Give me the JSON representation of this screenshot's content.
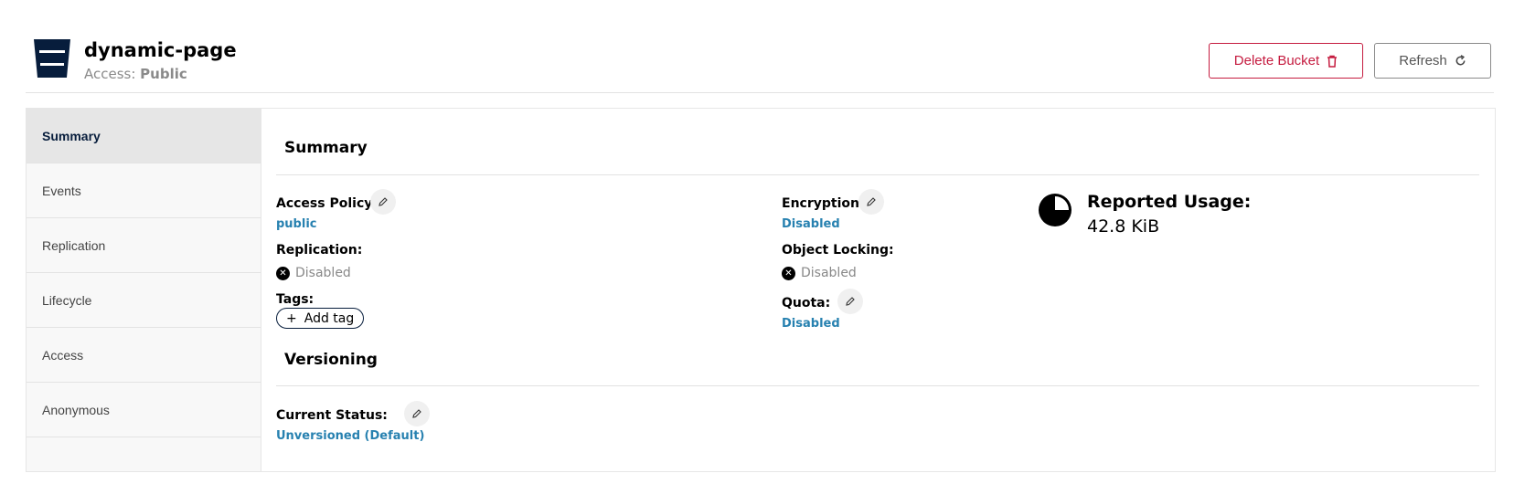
{
  "header": {
    "title": "dynamic-page",
    "access_label": "Access: ",
    "access_value": "Public",
    "delete_label": "Delete Bucket",
    "refresh_label": "Refresh",
    "delete_color": "#c51b3f"
  },
  "sidebar": {
    "items": [
      {
        "label": "Summary",
        "active": true
      },
      {
        "label": "Events"
      },
      {
        "label": "Replication"
      },
      {
        "label": "Lifecycle"
      },
      {
        "label": "Access"
      },
      {
        "label": "Anonymous"
      }
    ]
  },
  "summary": {
    "title": "Summary",
    "access_policy": {
      "label": "Access Policy:",
      "value": "public"
    },
    "replication": {
      "label": "Replication:",
      "value": "Disabled"
    },
    "tags": {
      "label": "Tags:",
      "add_label": "Add tag",
      "add_icon": "+"
    },
    "encryption": {
      "label": "Encryption:",
      "value": "Disabled"
    },
    "object_locking": {
      "label": "Object Locking:",
      "value": "Disabled"
    },
    "quota": {
      "label": "Quota:",
      "value": "Disabled"
    },
    "usage": {
      "label": "Reported Usage:",
      "value": "42.8 KiB"
    }
  },
  "versioning": {
    "title": "Versioning",
    "current_status": {
      "label": "Current Status:",
      "value": "Unversioned (Default)"
    }
  },
  "colors": {
    "link": "#2781b0",
    "navy": "#071d3c"
  },
  "icons": {
    "bucket": "bucket-icon",
    "trash": "trash-icon",
    "refresh": "refresh-icon",
    "edit": "pencil-icon",
    "disabled": "x-circle-icon",
    "usage": "pie-chart-icon"
  }
}
